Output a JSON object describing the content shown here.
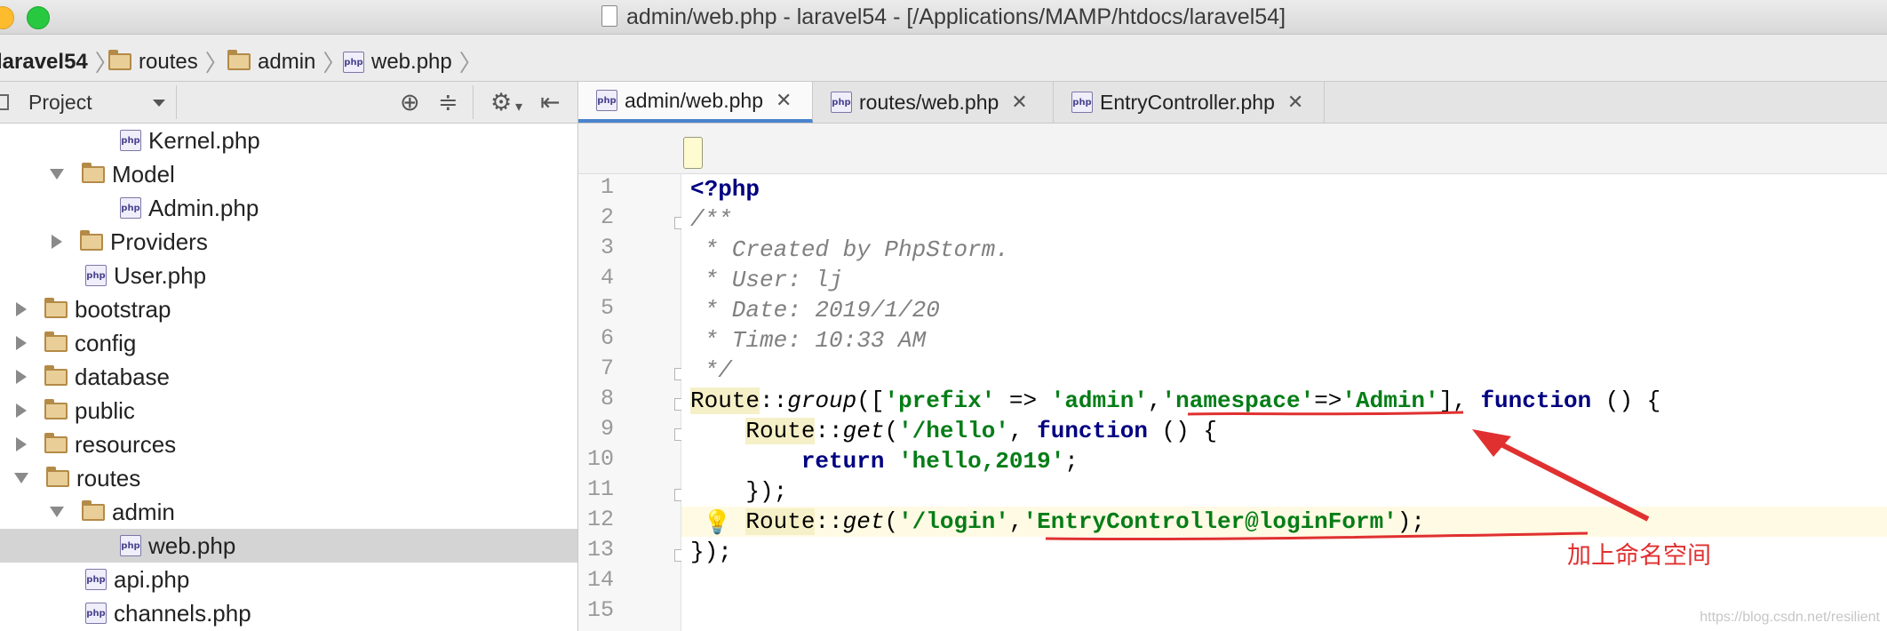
{
  "window": {
    "title": "admin/web.php - laravel54 - [/Applications/MAMP/htdocs/laravel54]"
  },
  "breadcrumb": [
    "laravel54",
    "routes",
    "admin",
    "web.php"
  ],
  "project_panel": {
    "label": "Project",
    "tree": [
      {
        "name": "Kernel.php",
        "type": "php",
        "indent": 3,
        "arrow": ""
      },
      {
        "name": "Model",
        "type": "folder",
        "indent": 2,
        "arrow": "down"
      },
      {
        "name": "Admin.php",
        "type": "php",
        "indent": 3,
        "arrow": ""
      },
      {
        "name": "Providers",
        "type": "folder",
        "indent": 2,
        "arrow": "right"
      },
      {
        "name": "User.php",
        "type": "php",
        "indent": 2,
        "arrow": ""
      },
      {
        "name": "bootstrap",
        "type": "folder",
        "indent": 1,
        "arrow": "right"
      },
      {
        "name": "config",
        "type": "folder",
        "indent": 1,
        "arrow": "right"
      },
      {
        "name": "database",
        "type": "folder",
        "indent": 1,
        "arrow": "right"
      },
      {
        "name": "public",
        "type": "folder",
        "indent": 1,
        "arrow": "right"
      },
      {
        "name": "resources",
        "type": "folder",
        "indent": 1,
        "arrow": "right"
      },
      {
        "name": "routes",
        "type": "folder",
        "indent": 1,
        "arrow": "down"
      },
      {
        "name": "admin",
        "type": "folder",
        "indent": 2,
        "arrow": "down"
      },
      {
        "name": "web.php",
        "type": "php",
        "indent": 3,
        "arrow": "",
        "selected": true
      },
      {
        "name": "api.php",
        "type": "php",
        "indent": 2,
        "arrow": ""
      },
      {
        "name": "channels.php",
        "type": "php",
        "indent": 2,
        "arrow": ""
      }
    ]
  },
  "tabs": [
    {
      "label": "admin/web.php",
      "active": true
    },
    {
      "label": "routes/web.php",
      "active": false
    },
    {
      "label": "EntryController.php",
      "active": false
    }
  ],
  "editor": {
    "line_numbers": [
      "1",
      "2",
      "3",
      "4",
      "5",
      "6",
      "7",
      "8",
      "9",
      "10",
      "11",
      "12",
      "13",
      "14",
      "15"
    ],
    "current_line": 12
  },
  "annotation": "加上命名空间",
  "watermark": "https://blog.csdn.net/resilient",
  "colors": {
    "annotation": "#e03030",
    "keyword": "#000080",
    "string": "#067d17",
    "comment": "#808080"
  }
}
